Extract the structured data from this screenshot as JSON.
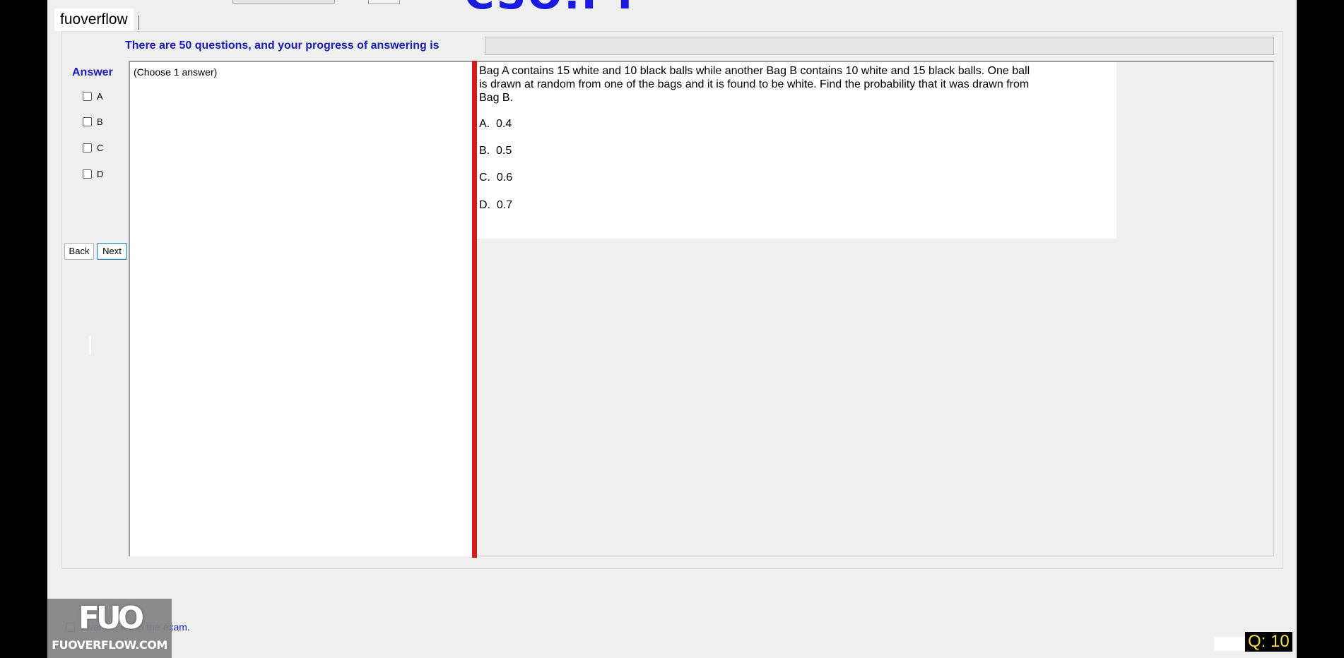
{
  "header": {
    "brand": "fuoverflow",
    "exam_code": "CSO:FT"
  },
  "progress": {
    "text": "There are 50 questions, and your progress of answering is",
    "value_percent": 0
  },
  "answer_panel": {
    "title": "Answer",
    "options": [
      "A",
      "B",
      "C",
      "D"
    ]
  },
  "nav": {
    "back_label": "Back",
    "next_label": "Next"
  },
  "choose_panel": {
    "instruction": "(Choose 1 answer)"
  },
  "question": {
    "line1": "Bag A contains 15 white and 10 black balls while another Bag B contains 10 white and 15 black balls. One ball",
    "line2": "is drawn at random from one of the bags and it is found to be white. Find the probability that it was drawn from",
    "line3": "Bag B.",
    "options": [
      {
        "letter": "A.",
        "value": "0.4"
      },
      {
        "letter": "B.",
        "value": "0.5"
      },
      {
        "letter": "C.",
        "value": "0.6"
      },
      {
        "letter": "D.",
        "value": "0.7"
      }
    ]
  },
  "finish": {
    "label": "I want to finish the exam."
  },
  "watermark": {
    "mark": "FUO",
    "site": "FUOVERFLOW.COM"
  },
  "question_counter": "Q: 10",
  "colors": {
    "accent_blue": "#1a1ab8",
    "splitter_red": "#d51a1a",
    "counter_yellow": "#f2e14a"
  }
}
